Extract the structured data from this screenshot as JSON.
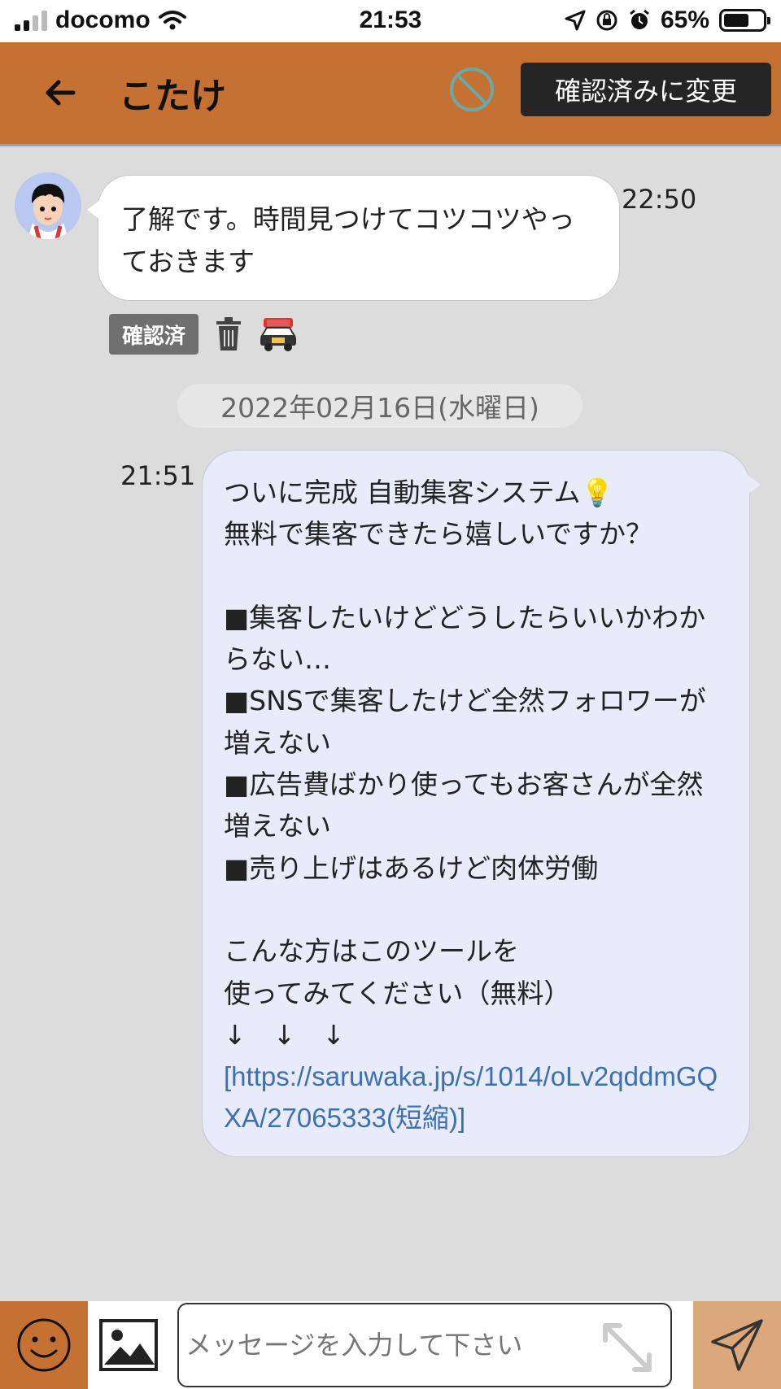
{
  "status_bar": {
    "carrier": "docomo",
    "time": "21:53",
    "battery": "65%"
  },
  "header": {
    "title": "こたけ",
    "confirm_button": "確認済みに変更"
  },
  "messages": {
    "incoming": {
      "text": "了解です。時間見つけてコツコツやっておきます",
      "time": "22:50",
      "badge": "確認済"
    },
    "date_separator": "2022年02月16日(水曜日)",
    "outgoing": {
      "time": "21:51",
      "text": "ついに完成 自動集客システム💡\n無料で集客できたら嬉しいですか？\n\n■集客したいけどどうしたらいいかわからない…\n■SNSで集客したけど全然フォロワーが増えない\n■広告費ばかり使ってもお客さんが全然増えない\n■売り上げはあるけど肉体労働\n\nこんな方はこのツールを\n使ってみてください（無料）\n↓　↓　↓\n",
      "link": "[https://saruwaka.jp/s/1014/oLv2qddmGQXA/27065333(短縮)]"
    }
  },
  "input": {
    "placeholder": "メッセージを入力して下さい"
  },
  "colors": {
    "header": "#c47133",
    "send": "#dba77c",
    "bubble_out": "#e8ecfa",
    "link": "#3d6fb3"
  }
}
